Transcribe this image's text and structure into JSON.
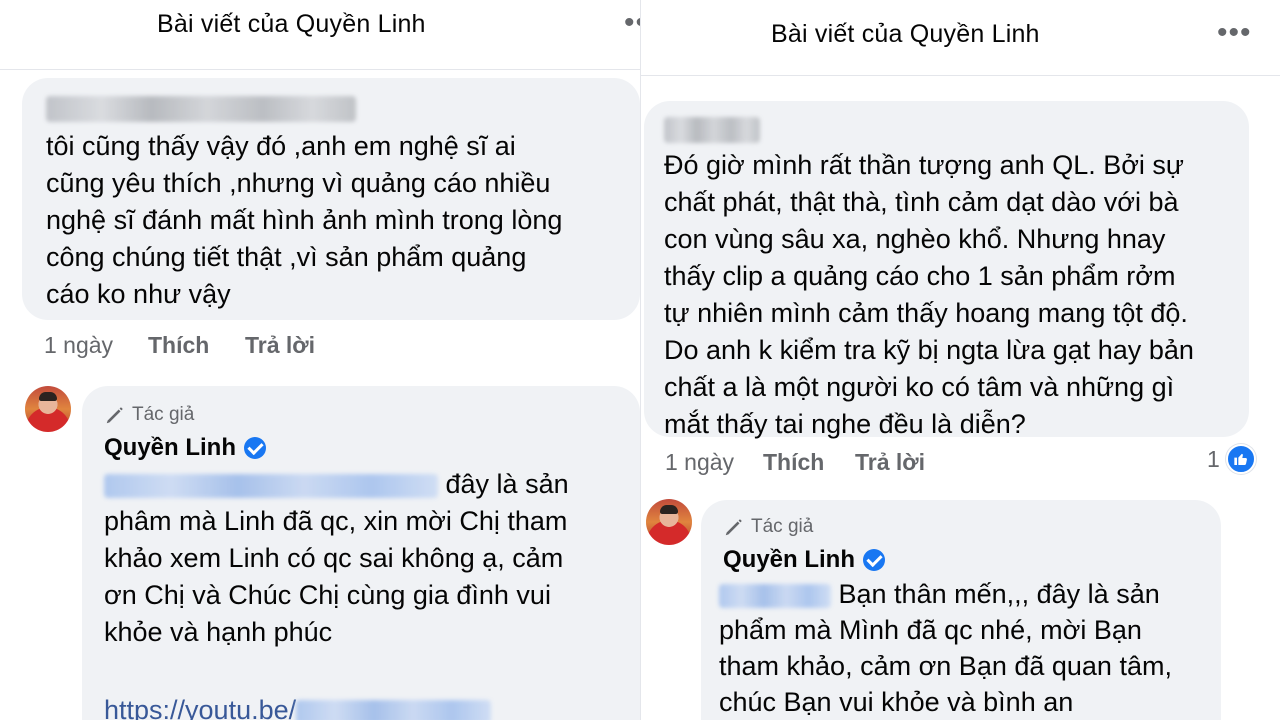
{
  "left": {
    "header_title": "Bài viết của Quyền Linh",
    "more_icon": "more-dots-icon",
    "comment": {
      "text_lines": [
        "tôi cũng thấy vậy đó ,anh em nghệ sĩ ai",
        "cũng yêu thích ,nhưng vì quảng cáo nhiều",
        "nghệ sĩ đánh mất hình ảnh mình trong lòng",
        "công chúng tiết thật ,vì sản phẩm quảng",
        "cáo ko như vậy"
      ],
      "time": "1 ngày",
      "like_label": "Thích",
      "reply_label": "Trả lời"
    },
    "reply": {
      "author_tag": "Tác giả",
      "author_name": "Quyền Linh",
      "first_line_text": "đây là sản",
      "text_lines": [
        "phâm mà Linh đã qc, xin mời Chị tham",
        "khảo xem Linh có qc sai không ạ, cảm",
        "ơn Chị và Chúc Chị cùng gia đình vui",
        "khỏe và hạnh phúc"
      ],
      "link_text": "https://youtu.be/"
    }
  },
  "right": {
    "header_title": "Bài viết của Quyền Linh",
    "more_icon": "more-dots-icon",
    "comment": {
      "text_lines": [
        "Đó giờ mình rất thần tượng anh QL. Bởi sự",
        "chất phát, thật thà, tình cảm dạt dào với bà",
        "con vùng sâu xa, nghèo khổ. Nhưng hnay",
        "thấy clip a quảng cáo cho 1 sản phẩm rởm",
        "tự nhiên mình cảm thấy hoang mang tột độ.",
        "Do anh k kiểm tra kỹ bị ngta lừa gạt hay bản",
        "chất a là một người ko có tâm và những gì",
        "mắt thấy tai nghe đều là diễn?"
      ],
      "time": "1 ngày",
      "like_label": "Thích",
      "reply_label": "Trả lời",
      "like_count": "1"
    },
    "reply": {
      "author_tag": "Tác giả",
      "author_name": "Quyền Linh",
      "first_line_text": "Bạn thân mến,,, đây là sản",
      "text_lines": [
        "phẩm mà Mình đã qc nhé, mời Bạn",
        "tham khảo, cảm ơn Bạn đã quan tâm,",
        "chúc Bạn vui khỏe và bình an"
      ]
    }
  },
  "colors": {
    "bubble_bg": "#f0f2f5",
    "secondary_text": "#65676b",
    "verified_blue": "#1877f2",
    "link": "#385898"
  }
}
